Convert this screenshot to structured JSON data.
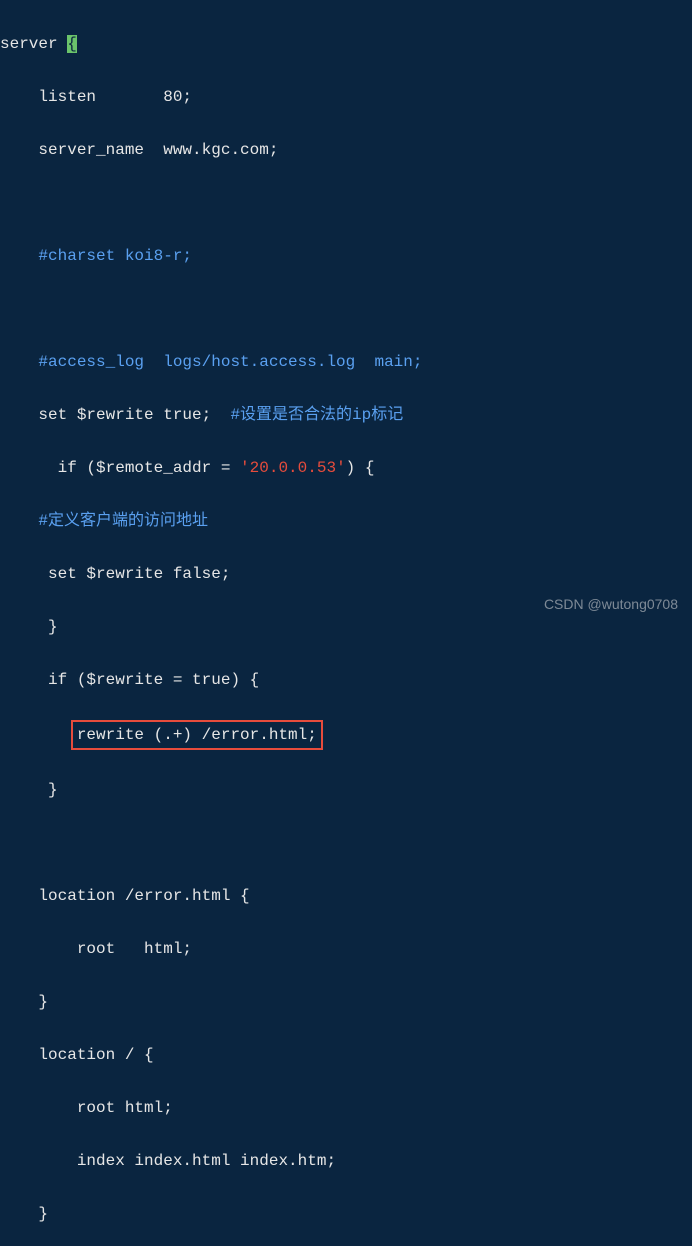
{
  "code": {
    "l1a": "server ",
    "l1b": "{",
    "l2": "    listen       80;",
    "l3": "    server_name  www.kgc.com;",
    "l4": "",
    "l5": "    #charset koi8-r;",
    "l6": "",
    "l7": "    #access_log  logs/host.access.log  main;",
    "l8a": "    set $rewrite true;  ",
    "l8b": "#设置是否合法的ip标记",
    "l9a": "      if ($remote_addr = ",
    "l9b": "'20.0.0.53'",
    "l9c": ") {",
    "l10": "    #定义客户端的访问地址",
    "l11": "     set $rewrite false;",
    "l12": "     }",
    "l13": "     if ($rewrite = true) {",
    "l14": "rewrite (.+) /error.html;",
    "l14pad": "        ",
    "l15": "     }",
    "l16": "",
    "l17": "    location /error.html {",
    "l18": "        root   html;",
    "l19": "    }",
    "l20": "    location / {",
    "l21": "        root html;",
    "l22": "        index index.html index.htm;",
    "l23": "    }"
  },
  "watermark": "CSDN @wutong0708"
}
